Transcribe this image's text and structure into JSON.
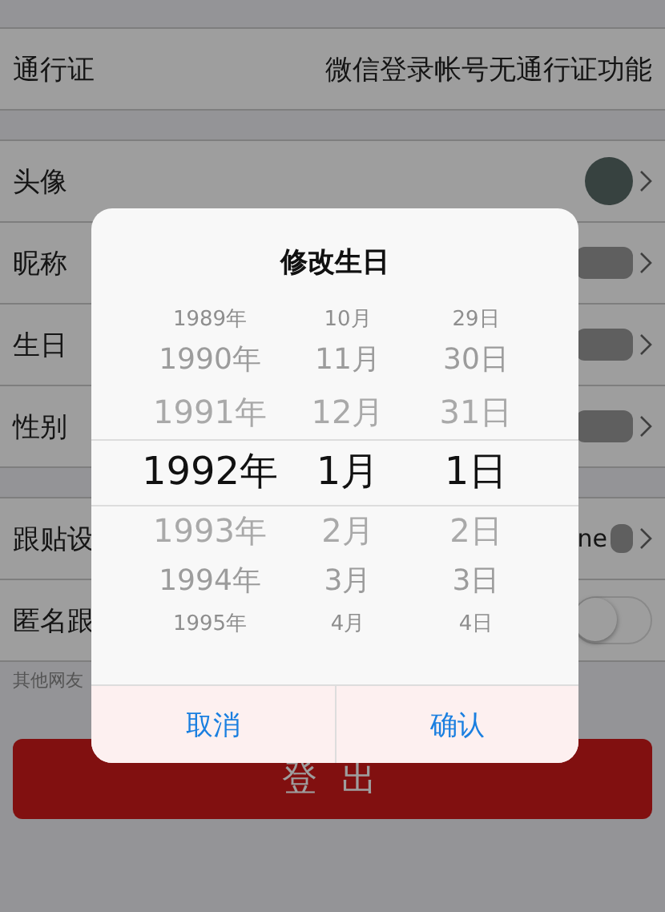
{
  "settings_groups": [
    {
      "rows": [
        {
          "kind": "text",
          "label": "通行证",
          "value": "微信登录帐号无通行证功能"
        }
      ]
    },
    {
      "rows": [
        {
          "kind": "avatar",
          "label": "头像"
        },
        {
          "kind": "masked",
          "label": "昵称"
        },
        {
          "kind": "masked",
          "label": "生日"
        },
        {
          "kind": "masked",
          "label": "性别"
        }
      ]
    },
    {
      "rows": [
        {
          "kind": "text_masked",
          "label": "跟贴设",
          "value": "ne"
        },
        {
          "kind": "toggle",
          "label": "匿名跟",
          "on": false
        }
      ]
    }
  ],
  "footnote": "其他网友",
  "logout_button": "登 出",
  "dialog": {
    "title": "修改生日",
    "picker": [
      {
        "items": [
          {
            "label": "1989年",
            "selected": false
          },
          {
            "label": "1990年",
            "selected": false
          },
          {
            "label": "1991年",
            "selected": false
          },
          {
            "label": "1992年",
            "selected": true
          },
          {
            "label": "1993年",
            "selected": false
          },
          {
            "label": "1994年",
            "selected": false
          },
          {
            "label": "1995年",
            "selected": false
          }
        ]
      },
      {
        "items": [
          {
            "label": "10月",
            "selected": false
          },
          {
            "label": "11月",
            "selected": false
          },
          {
            "label": "12月",
            "selected": false
          },
          {
            "label": "1月",
            "selected": true
          },
          {
            "label": "2月",
            "selected": false
          },
          {
            "label": "3月",
            "selected": false
          },
          {
            "label": "4月",
            "selected": false
          }
        ]
      },
      {
        "items": [
          {
            "label": "29日",
            "selected": false
          },
          {
            "label": "30日",
            "selected": false
          },
          {
            "label": "31日",
            "selected": false
          },
          {
            "label": "1日",
            "selected": true
          },
          {
            "label": "2日",
            "selected": false
          },
          {
            "label": "3日",
            "selected": false
          },
          {
            "label": "4日",
            "selected": false
          }
        ]
      }
    ],
    "buttons": [
      "取消",
      "确认"
    ]
  }
}
